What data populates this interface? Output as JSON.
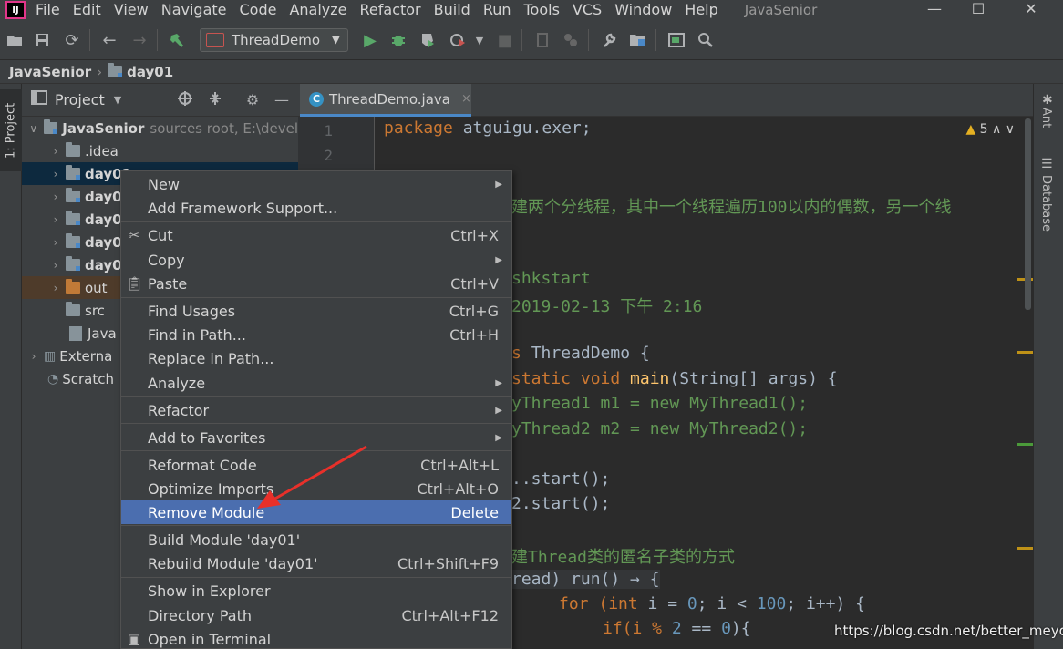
{
  "menubar": {
    "logo": "IJ",
    "items": [
      "File",
      "Edit",
      "View",
      "Navigate",
      "Code",
      "Analyze",
      "Refactor",
      "Build",
      "Run",
      "Tools",
      "VCS",
      "Window",
      "Help"
    ],
    "window_title": "JavaSenior",
    "controls": {
      "minimize": "—",
      "maximize": "☐",
      "close": "✕"
    }
  },
  "toolbar": {
    "run_config": "ThreadDemo"
  },
  "breadcrumb": {
    "project": "JavaSenior",
    "module": "day01"
  },
  "left_strip": {
    "project_tab": "1: Project"
  },
  "right_strip": {
    "ant": "Ant",
    "database": "Database"
  },
  "project_panel": {
    "title": "Project",
    "tree": [
      {
        "label": "JavaSenior",
        "muted": "sources root,  E:\\devel"
      },
      {
        "label": ".idea"
      },
      {
        "label": "day01"
      },
      {
        "label": "day0"
      },
      {
        "label": "day0"
      },
      {
        "label": "day0"
      },
      {
        "label": "day0"
      },
      {
        "label": "out"
      },
      {
        "label": "src"
      },
      {
        "label": "Java"
      },
      {
        "label": "Externa"
      },
      {
        "label": "Scratch"
      }
    ]
  },
  "editor": {
    "tab": "ThreadDemo.java",
    "tab_close": "×",
    "warnings": "5",
    "line_numbers": [
      "1",
      "2"
    ],
    "code": {
      "l1a": "package ",
      "l1b": "atguigu.exer;",
      "l2": "建两个分线程，其中一个线程遍历100以内的偶数，另一个线",
      "l3": "shkstart",
      "l4": "2019-02-13 下午 2:16",
      "l5a": "s ",
      "l5b": "ThreadDemo {",
      "l6a": "static void ",
      "l6b": "main",
      "l6c": "(String[] args) {",
      "l7": "yThread1 m1 = new MyThread1();",
      "l8": "yThread2 m2 = new MyThread2();",
      "l9": "..start();",
      "l10": "2.start();",
      "l11": "建Thread类的匿名子类的方式",
      "l12": "read) run() → {",
      "l13a": "for (",
      "l13b": "int ",
      "l13c": "i = ",
      "l13d": "0",
      "l13e": "; i < ",
      "l13f": "100",
      "l13g": "; i++) {",
      "l14a": "if(i % ",
      "l14b": "2",
      "l14c": " == ",
      "l14d": "0",
      "l14e": "){"
    }
  },
  "context_menu": {
    "items": [
      {
        "label": "New",
        "shortcut": "",
        "submenu": true
      },
      {
        "label": "Add Framework Support...",
        "shortcut": ""
      },
      {
        "label": "Cut",
        "shortcut": "Ctrl+X",
        "icon": "scissors-icon"
      },
      {
        "label": "Copy",
        "shortcut": "",
        "submenu": true
      },
      {
        "label": "Paste",
        "shortcut": "Ctrl+V",
        "icon": "clipboard-icon"
      },
      {
        "label": "Find Usages",
        "shortcut": "Ctrl+G"
      },
      {
        "label": "Find in Path...",
        "shortcut": "Ctrl+H"
      },
      {
        "label": "Replace in Path...",
        "shortcut": ""
      },
      {
        "label": "Analyze",
        "shortcut": "",
        "submenu": true
      },
      {
        "label": "Refactor",
        "shortcut": "",
        "submenu": true
      },
      {
        "label": "Add to Favorites",
        "shortcut": "",
        "submenu": true
      },
      {
        "label": "Reformat Code",
        "shortcut": "Ctrl+Alt+L"
      },
      {
        "label": "Optimize Imports",
        "shortcut": "Ctrl+Alt+O"
      },
      {
        "label": "Remove Module",
        "shortcut": "Delete",
        "highlighted": true
      },
      {
        "label": "Build Module 'day01'",
        "shortcut": ""
      },
      {
        "label": "Rebuild Module 'day01'",
        "shortcut": "Ctrl+Shift+F9"
      },
      {
        "label": "Show in Explorer",
        "shortcut": ""
      },
      {
        "label": "Directory Path",
        "shortcut": "Ctrl+Alt+F12"
      },
      {
        "label": "Open in Terminal",
        "shortcut": "",
        "icon": "terminal-icon"
      }
    ]
  },
  "watermark": "https://blog.csdn.net/better_meyou",
  "colors": {
    "highlight": "#4b6eaf",
    "annotation_arrow": "#e8302a"
  }
}
